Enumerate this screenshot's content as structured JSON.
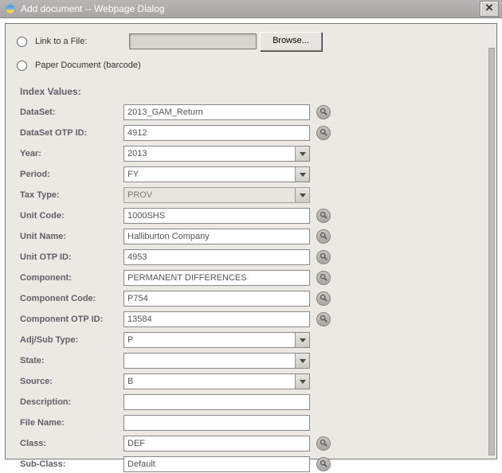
{
  "window": {
    "title": "Add document -- Webpage Dialog"
  },
  "upload": {
    "link_label": "Link to a File:",
    "browse_label": "Browse...",
    "paper_label": "Paper Document (barcode)"
  },
  "section_title": "Index Values:",
  "fields": {
    "dataset": {
      "label": "DataSet:",
      "value": "2013_GAM_Return",
      "type": "text",
      "lookup": true
    },
    "dataset_otp": {
      "label": "DataSet OTP ID:",
      "value": "4912",
      "type": "text",
      "lookup": true
    },
    "year": {
      "label": "Year:",
      "value": "2013",
      "type": "select",
      "lookup": false
    },
    "period": {
      "label": "Period:",
      "value": "FY",
      "type": "select",
      "lookup": false
    },
    "tax_type": {
      "label": "Tax Type:",
      "value": "PROV",
      "type": "readonly_select",
      "lookup": false
    },
    "unit_code": {
      "label": "Unit Code:",
      "value": "1000SHS",
      "type": "text",
      "lookup": true
    },
    "unit_name": {
      "label": "Unit Name:",
      "value": "Halliburton Company",
      "type": "text",
      "lookup": true
    },
    "unit_otp": {
      "label": "Unit OTP ID:",
      "value": "4953",
      "type": "text",
      "lookup": true
    },
    "component": {
      "label": "Component:",
      "value": "PERMANENT DIFFERENCES",
      "type": "text",
      "lookup": true
    },
    "component_code": {
      "label": "Component Code:",
      "value": "P754",
      "type": "text",
      "lookup": true
    },
    "component_otp": {
      "label": "Component OTP ID:",
      "value": "13584",
      "type": "text",
      "lookup": true
    },
    "adj_sub": {
      "label": "Adj/Sub Type:",
      "value": "P",
      "type": "select",
      "lookup": false
    },
    "state": {
      "label": "State:",
      "value": "",
      "type": "select",
      "lookup": false
    },
    "source": {
      "label": "Source:",
      "value": "B",
      "type": "select",
      "lookup": false
    },
    "description": {
      "label": "Description:",
      "value": "",
      "type": "text",
      "lookup": false
    },
    "file_name": {
      "label": "File Name:",
      "value": "",
      "type": "text",
      "lookup": false
    },
    "class": {
      "label": "Class:",
      "value": "DEF",
      "type": "text",
      "lookup": true
    },
    "sub_class": {
      "label": "Sub-Class:",
      "value": "Default",
      "type": "text",
      "lookup": true
    }
  },
  "field_order": [
    "dataset",
    "dataset_otp",
    "year",
    "period",
    "tax_type",
    "unit_code",
    "unit_name",
    "unit_otp",
    "component",
    "component_code",
    "component_otp",
    "adj_sub",
    "state",
    "source",
    "description",
    "file_name",
    "class",
    "sub_class"
  ]
}
